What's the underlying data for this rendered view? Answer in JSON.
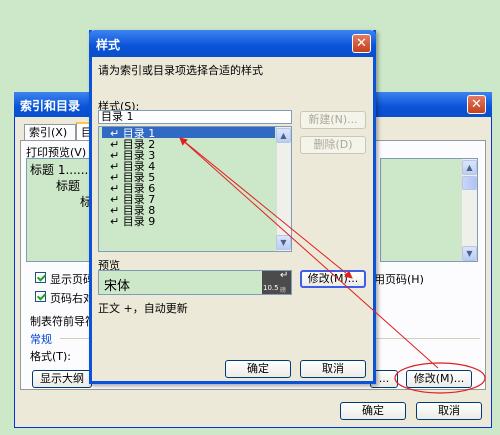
{
  "back_dialog": {
    "title": "索引和目录",
    "tab_index": "索引(X)",
    "tab_toc_partial": "目",
    "print_preview_label": "打印预览(V)",
    "preview_lines": [
      "标题 1......",
      "标题 ",
      "标"
    ],
    "chk_show_page": "显示页码",
    "chk_right_align": "页码右对",
    "tab_leader_label": "制表符前导符",
    "right_hyperlink_label": "用页码(H)",
    "general_label": "常规",
    "format_label": "格式(T):",
    "outline_button": "显示大纲",
    "dots_button": "...",
    "modify_button": "修改(M)...",
    "ok_button": "确定",
    "cancel_button": "取消"
  },
  "style_dialog": {
    "title": "样式",
    "instruction": "请为索引或目录项选择合适的样式",
    "styles_label": "样式(S):",
    "current_style": "目录 1",
    "style_items": [
      "目录 1",
      "目录 2",
      "目录 3",
      "目录 4",
      "目录 5",
      "目录 6",
      "目录 7",
      "目录 8",
      "目录 9"
    ],
    "selected_index": 0,
    "new_button": "新建(N)...",
    "delete_button": "删除(D)",
    "preview_label": "预览",
    "preview_font": "宋体",
    "preview_size": "10.5",
    "preview_size_unit": "磅",
    "modify_button": "修改(M)...",
    "description": "正文 +，自动更新",
    "ok_button": "确定",
    "cancel_button": "取消"
  },
  "colors": {
    "xp_blue": "#0a53d8",
    "dialog_bg": "#ece9d8",
    "list_bg": "#cde7c9",
    "selection": "#316ac5",
    "annotation_red": "#e02020"
  }
}
